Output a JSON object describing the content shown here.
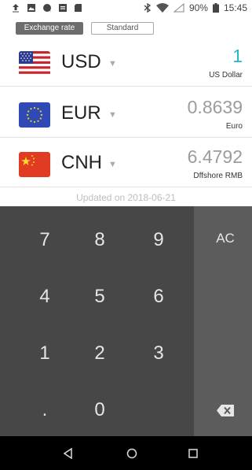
{
  "status_bar": {
    "battery": "90%",
    "time": "15:45",
    "icons": [
      "upload-icon",
      "image-icon",
      "chat-icon",
      "sim-icon",
      "sd-card-icon",
      "bluetooth-icon",
      "wifi-icon",
      "signal-icon",
      "battery-icon"
    ]
  },
  "mode": {
    "exchange_rate_label": "Exchange rate",
    "standard_label": "Standard",
    "selected": "Exchange rate"
  },
  "currencies": [
    {
      "code": "USD",
      "name": "US Dollar",
      "value": "1",
      "flag": "us-flag-icon",
      "active": true
    },
    {
      "code": "EUR",
      "name": "Euro",
      "value": "0.8639",
      "flag": "eu-flag-icon",
      "active": false
    },
    {
      "code": "CNH",
      "name": "Dffshore RMB",
      "value": "6.4792",
      "flag": "cn-flag-icon",
      "active": false
    }
  ],
  "updated_text": "Updated on 2018-06-21",
  "keypad": {
    "keys": [
      "7",
      "8",
      "9",
      "4",
      "5",
      "6",
      "1",
      "2",
      "3",
      ".",
      "0"
    ],
    "clear_label": "AC",
    "backspace_icon": "backspace-icon"
  },
  "colors": {
    "accent": "#2ab3c1",
    "keypad_bg": "#474747",
    "keypad_side_bg": "#5c5c5c"
  },
  "nav_bar": {
    "icons": [
      "back-icon",
      "home-icon",
      "recents-icon"
    ]
  }
}
